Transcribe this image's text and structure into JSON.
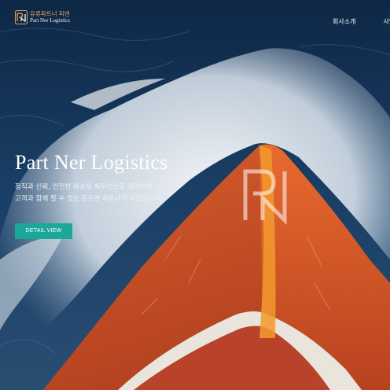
{
  "header": {
    "logo": {
      "name_ko": "유류파트너 피엔",
      "name_en": "Part Ner Logistics",
      "mark": "PN"
    },
    "nav": [
      {
        "label": "회사소개"
      },
      {
        "label": "사업"
      }
    ]
  },
  "hero": {
    "title": "Part Ner Logistics",
    "subtitle_lines": [
      "정직과 신뢰, 안전한 배송을 최우선으로 생각하며",
      "고객과 함께 할 수 있는 든든한 파트너가 되겠습니다."
    ],
    "button_label": "DETAIL VIEW",
    "watermark": "PN"
  },
  "colors": {
    "accent": "#1ba89a",
    "logo_gold": "#e2a35a",
    "hull_orange": "#d9562a",
    "sea": "#163a63"
  },
  "icons": [
    "pn-logo-icon",
    "pn-watermark-icon"
  ]
}
